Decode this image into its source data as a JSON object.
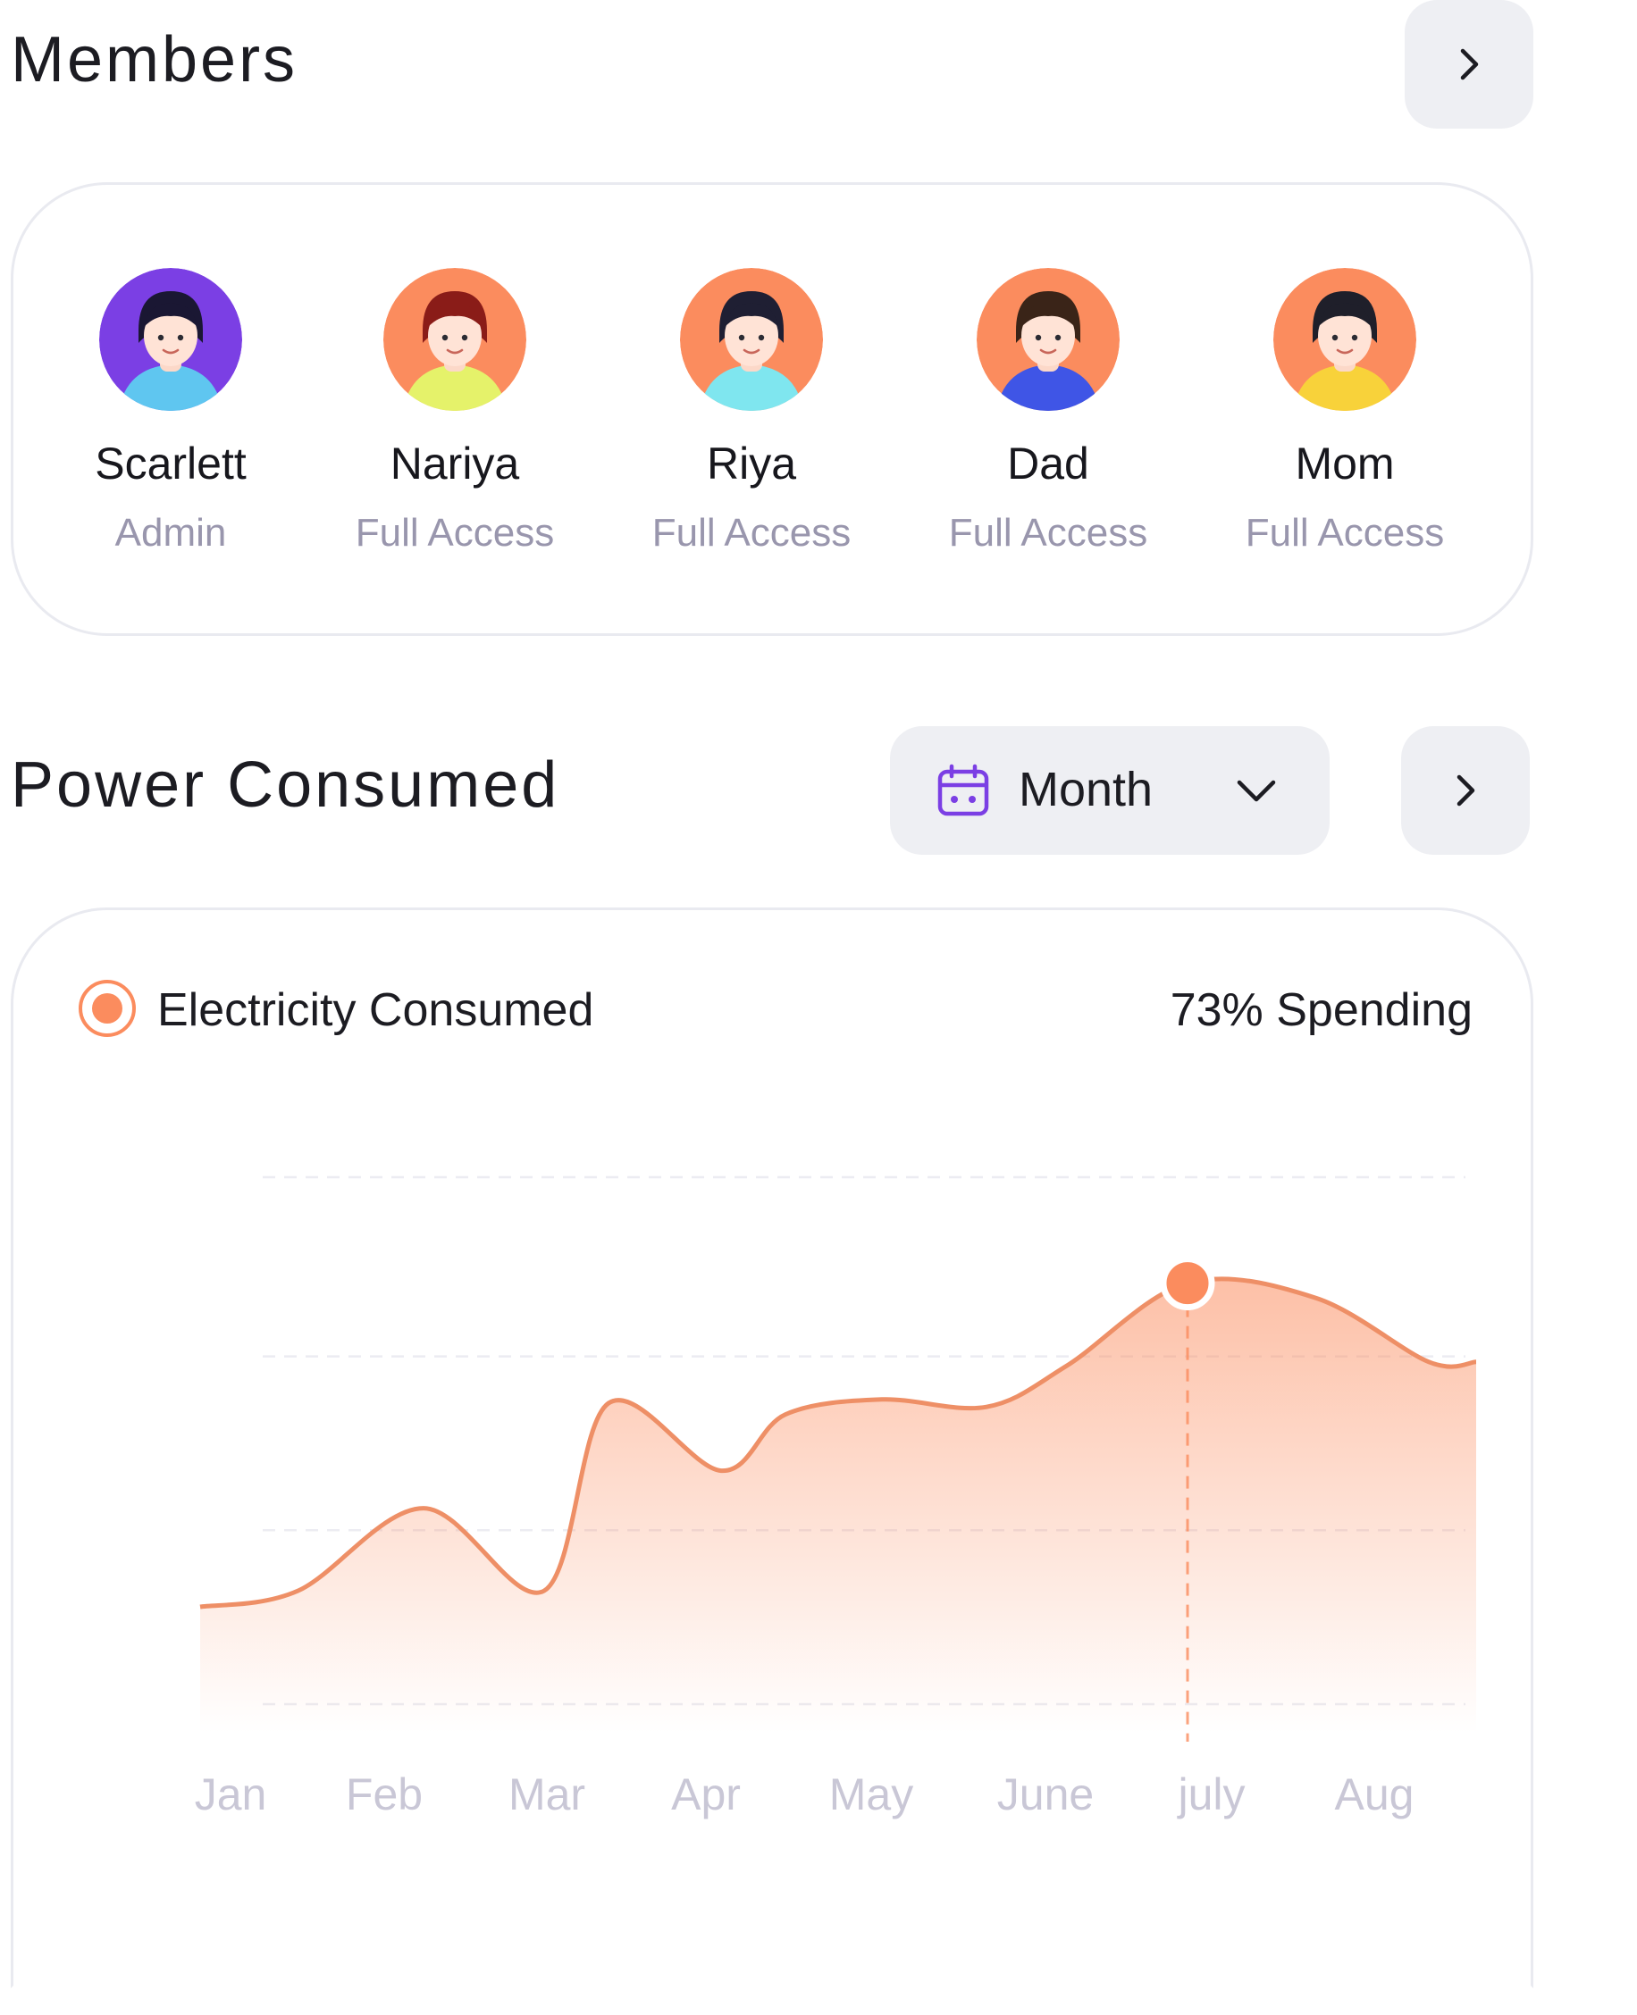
{
  "members": {
    "title": "Members",
    "list": [
      {
        "name": "Scarlett",
        "role": "Admin",
        "bg": "#7b3fe4",
        "shirt": "#5fc6f0",
        "hair": "#1a1733"
      },
      {
        "name": "Nariya",
        "role": "Full Access",
        "bg": "#fb8c5e",
        "shirt": "#e5f26a",
        "hair": "#8a1c18"
      },
      {
        "name": "Riya",
        "role": "Full Access",
        "bg": "#fb8c5e",
        "shirt": "#7fe6ef",
        "hair": "#1f1f33"
      },
      {
        "name": "Dad",
        "role": "Full Access",
        "bg": "#fb8c5e",
        "shirt": "#3f55e6",
        "hair": "#3a2418"
      },
      {
        "name": "Mom",
        "role": "Full Access",
        "bg": "#fb8c5e",
        "shirt": "#f8d23a",
        "hair": "#1f1f2a"
      }
    ]
  },
  "power": {
    "title": "Power Consumed",
    "period": "Month",
    "legend": "Electricity Consumed",
    "spending": "73% Spending"
  },
  "icons": {
    "members_next": "chevron-right-icon",
    "power_next": "chevron-right-icon",
    "calendar": "calendar-icon",
    "dropdown": "chevron-down-icon"
  },
  "colors": {
    "accent": "#fb8c5e",
    "calendar": "#7b3fe4",
    "button_bg": "#eeeff3",
    "muted_text": "#9996ad"
  },
  "chart_data": {
    "type": "area",
    "categories": [
      "Jan",
      "Feb",
      "Mar",
      "Apr",
      "May",
      "June",
      "july",
      "Aug"
    ],
    "x": [
      0.42,
      1.2,
      1.95,
      2.35,
      3.05,
      3.45,
      4.05,
      4.7,
      5.2,
      5.95,
      6.75,
      7.45
    ],
    "values": [
      0.35,
      0.57,
      0.35,
      0.85,
      0.67,
      0.82,
      0.86,
      0.84,
      0.95,
      1.17,
      1.13,
      0.96
    ],
    "highlight_index": 9,
    "gridlines": 4,
    "ylim": [
      0,
      1.2
    ],
    "legend_placement": "top-left"
  }
}
